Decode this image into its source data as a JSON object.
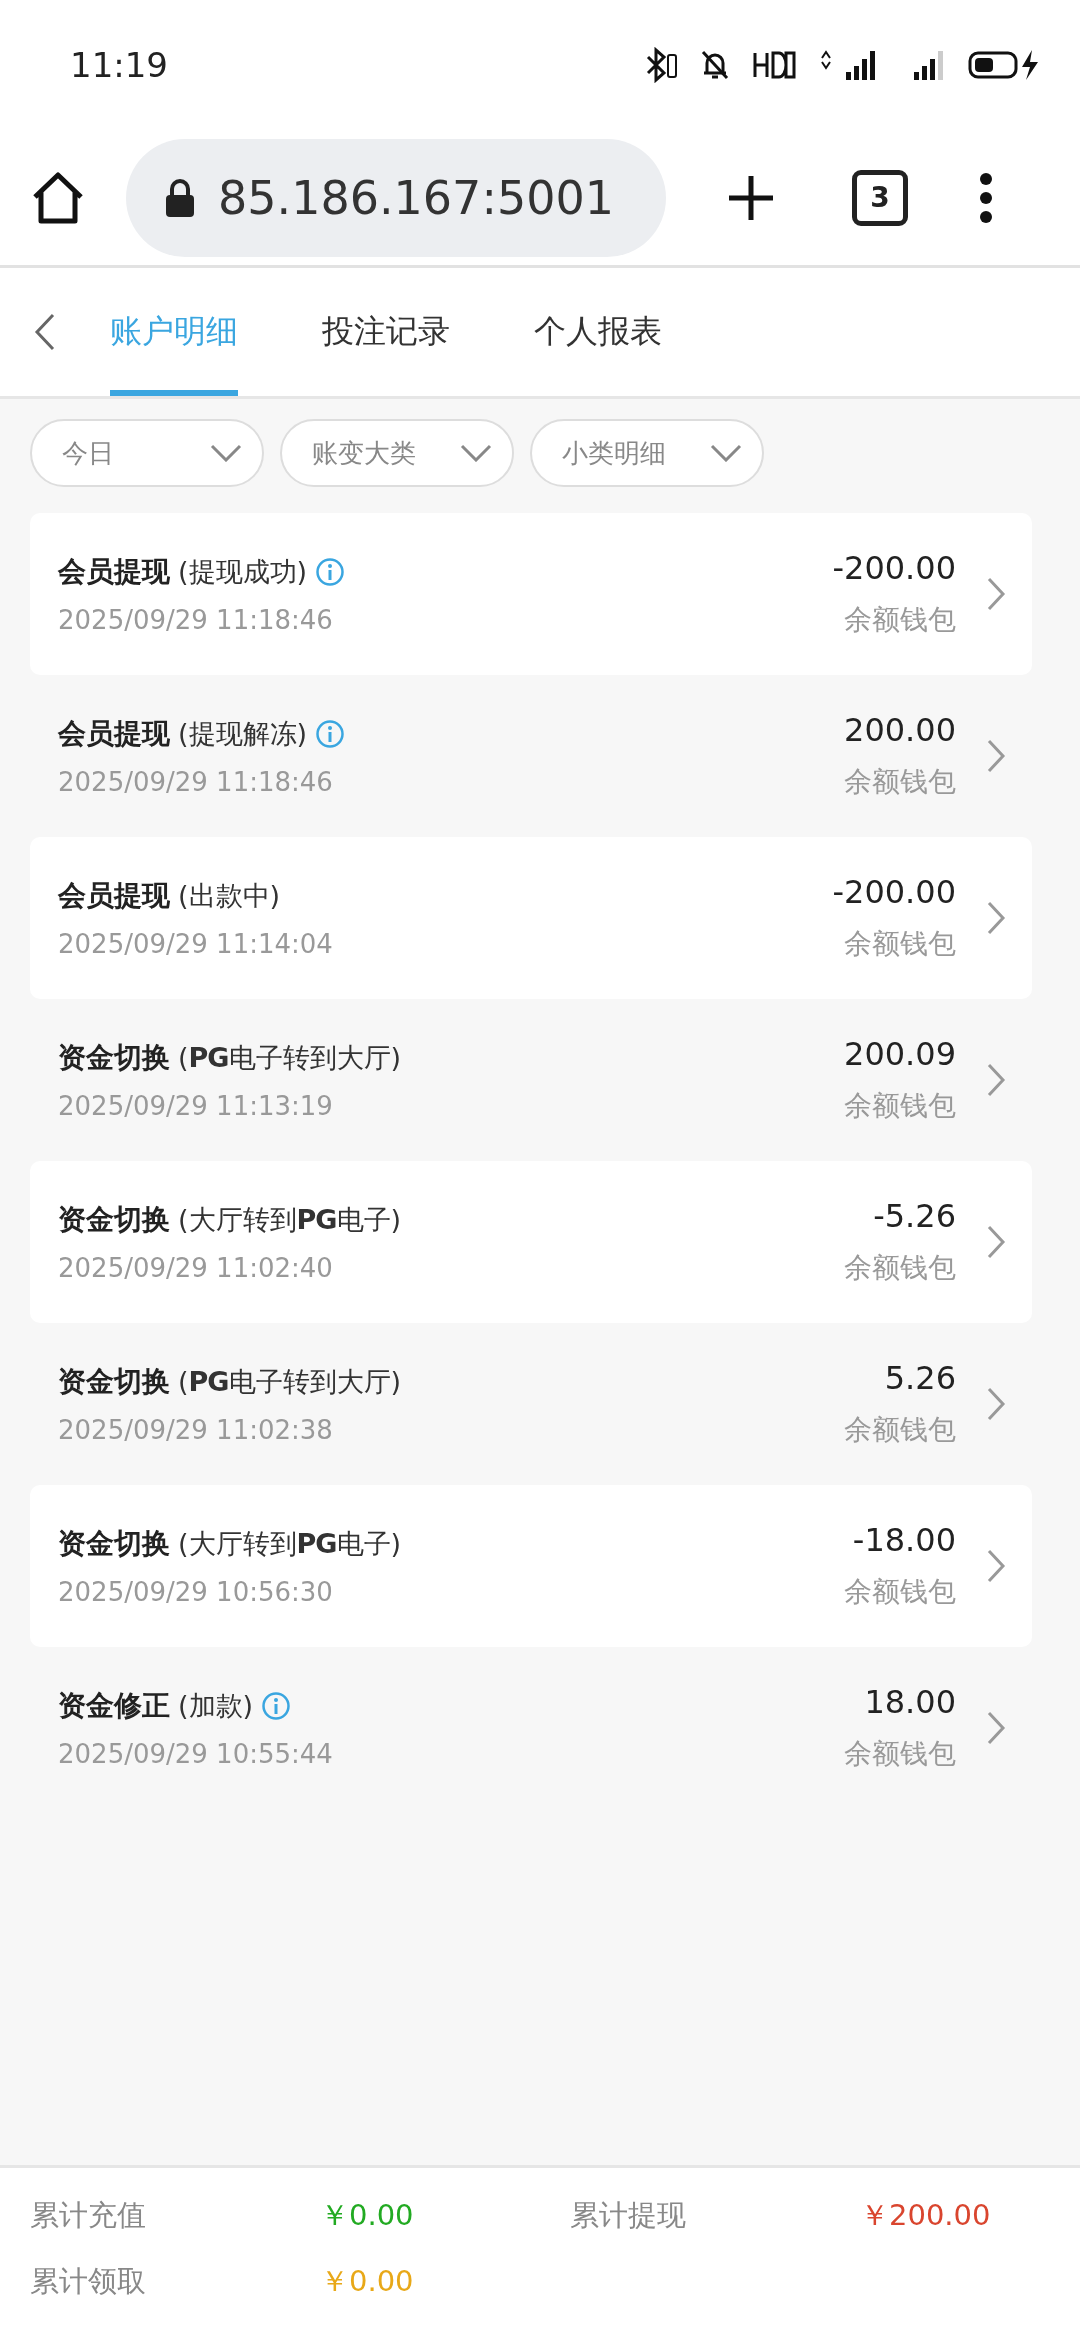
{
  "status_bar": {
    "time": "11:19"
  },
  "browser": {
    "url": "85.186.167:5001",
    "tab_count": "3"
  },
  "tabs": [
    {
      "label": "账户明细",
      "selected": true
    },
    {
      "label": "投注记录",
      "selected": false
    },
    {
      "label": "个人报表",
      "selected": false
    }
  ],
  "filters": [
    "今日",
    "账变大类",
    "小类明细"
  ],
  "records": [
    {
      "title": "会员提现",
      "detail": "(提现成功)",
      "info": true,
      "time": "2025/09/29 11:18:46",
      "amount": "-200.00",
      "wallet": "余额钱包"
    },
    {
      "title": "会员提现",
      "detail": "(提现解冻)",
      "info": true,
      "time": "2025/09/29 11:18:46",
      "amount": "200.00",
      "wallet": "余额钱包"
    },
    {
      "title": "会员提现",
      "detail": "(出款中)",
      "info": false,
      "time": "2025/09/29 11:14:04",
      "amount": "-200.00",
      "wallet": "余额钱包"
    },
    {
      "title": "资金切换",
      "detail": "(**PG**电子转到大厅)",
      "info": false,
      "time": "2025/09/29 11:13:19",
      "amount": "200.09",
      "wallet": "余额钱包"
    },
    {
      "title": "资金切换",
      "detail": "(大厅转到**PG**电子)",
      "info": false,
      "time": "2025/09/29 11:02:40",
      "amount": "-5.26",
      "wallet": "余额钱包"
    },
    {
      "title": "资金切换",
      "detail": "(**PG**电子转到大厅)",
      "info": false,
      "time": "2025/09/29 11:02:38",
      "amount": "5.26",
      "wallet": "余额钱包"
    },
    {
      "title": "资金切换",
      "detail": "(大厅转到**PG**电子)",
      "info": false,
      "time": "2025/09/29 10:56:30",
      "amount": "-18.00",
      "wallet": "余额钱包"
    },
    {
      "title": "资金修正",
      "detail": "(加款)",
      "info": true,
      "time": "2025/09/29 10:55:44",
      "amount": "18.00",
      "wallet": "余额钱包"
    }
  ],
  "totals": [
    {
      "label": "累计充值",
      "value": "￥0.00",
      "color": "#22aa22"
    },
    {
      "label": "累计提现",
      "value": "￥200.00",
      "color": "#d9452e"
    },
    {
      "label": "累计领取",
      "value": "￥0.00",
      "color": "#e8a818"
    }
  ]
}
